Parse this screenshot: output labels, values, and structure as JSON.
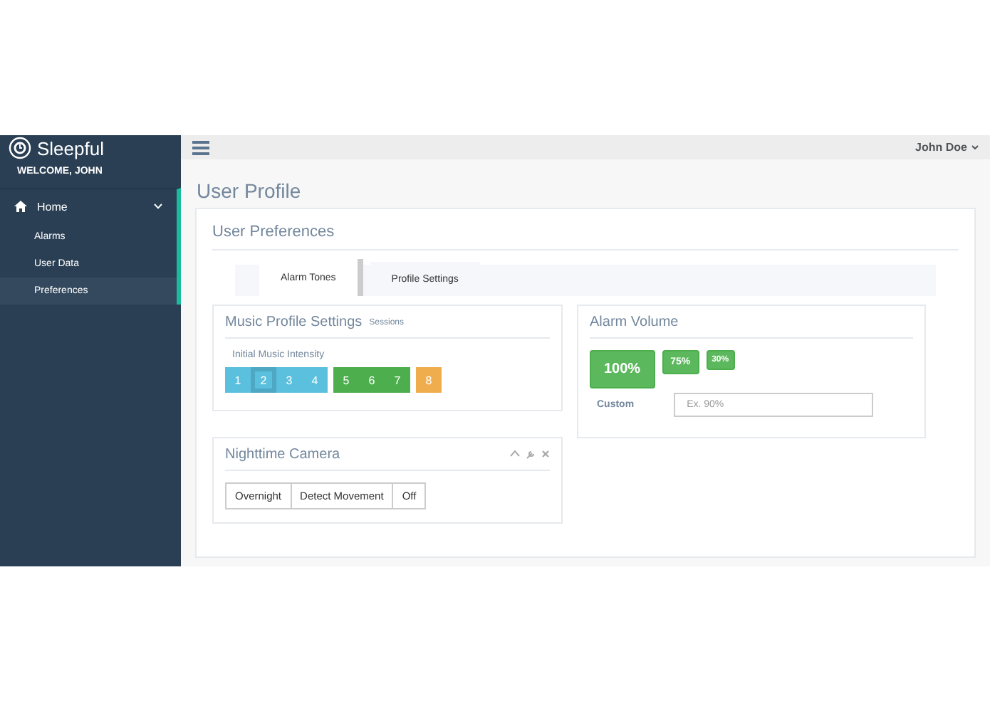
{
  "brand": {
    "name": "Sleepful",
    "welcome": "WELCOME, JOHN"
  },
  "sidebar": {
    "items": [
      {
        "label": "Home",
        "expanded": true,
        "children": [
          {
            "label": "Alarms",
            "selected": false
          },
          {
            "label": "User Data",
            "selected": false
          },
          {
            "label": "Preferences",
            "selected": true
          }
        ]
      }
    ]
  },
  "top_bar": {
    "user": "John Doe"
  },
  "page_title": "User Profile",
  "panel": {
    "title": "User Preferences",
    "tabs": [
      {
        "label": "Alarm Tones",
        "selected": true
      },
      {
        "label": "Profile Settings",
        "selected": false
      }
    ],
    "music": {
      "title": "Music Profile Settings",
      "subtitle": "Sessions",
      "label": "Initial Music Intensity",
      "levels": [
        {
          "label": "1",
          "color": "#5bc0de",
          "selected": false
        },
        {
          "label": "2",
          "color": "#5bc0de",
          "selected": true
        },
        {
          "label": "3",
          "color": "#5bc0de",
          "selected": false
        },
        {
          "label": "4",
          "color": "#5bc0de",
          "selected": false
        },
        {
          "label": "5",
          "color": "#4cae4c",
          "selected": false
        },
        {
          "label": "6",
          "color": "#4cae4c",
          "selected": false
        },
        {
          "label": "7",
          "color": "#4cae4c",
          "selected": false
        },
        {
          "label": "8",
          "color": "#f0ad4e",
          "selected": false
        }
      ]
    },
    "camera": {
      "title": "Nighttime Camera",
      "options": [
        {
          "label": "Overnight"
        },
        {
          "label": "Detect Movement"
        },
        {
          "label": "Off"
        }
      ]
    },
    "volume": {
      "title": "Alarm Volume",
      "buttons": [
        {
          "label": "100%",
          "kind": "large"
        },
        {
          "label": "75%",
          "kind": "small"
        },
        {
          "label": "30%",
          "kind": "xsmall"
        }
      ],
      "custom_label": "Custom",
      "custom_placeholder": "Ex. 90%"
    }
  }
}
